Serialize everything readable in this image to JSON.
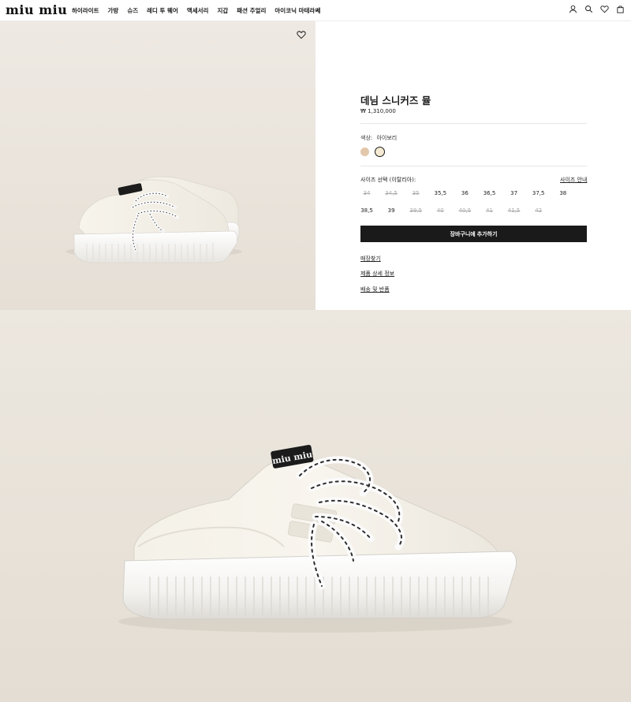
{
  "header": {
    "logo": "miu miu",
    "nav": [
      "하이라이트",
      "가방",
      "슈즈",
      "레디 투 웨어",
      "액세서리",
      "지갑",
      "패션 주얼리",
      "아이코닉 마테라쎄"
    ],
    "icons": [
      "account-icon",
      "search-icon",
      "wishlist-icon",
      "bag-icon"
    ]
  },
  "product": {
    "title": "데님 스니커즈 뮬",
    "price": "₩ 1,310,000",
    "color_label": "색상:",
    "color_value": "아이보리",
    "swatches": [
      "#e3c7ab",
      "#f4ead2"
    ],
    "size_label": "사이즈 선택 (이탈리아):",
    "size_guide": "사이즈 안내",
    "sizes_row1": [
      {
        "v": "34",
        "available": false
      },
      {
        "v": "34,5",
        "available": false
      },
      {
        "v": "35",
        "available": false
      },
      {
        "v": "35,5",
        "available": true
      },
      {
        "v": "36",
        "available": true
      },
      {
        "v": "36,5",
        "available": true
      },
      {
        "v": "37",
        "available": true
      },
      {
        "v": "37,5",
        "available": true
      },
      {
        "v": "38",
        "available": true
      }
    ],
    "sizes_row2": [
      {
        "v": "38,5",
        "available": true
      },
      {
        "v": "39",
        "available": true
      },
      {
        "v": "39,5",
        "available": false
      },
      {
        "v": "40",
        "available": false
      },
      {
        "v": "40,5",
        "available": false
      },
      {
        "v": "41",
        "available": false
      },
      {
        "v": "41,5",
        "available": false
      },
      {
        "v": "42",
        "available": false
      }
    ],
    "add_to_cart": "장바구니에 추가하기",
    "links": [
      "매장찾기",
      "제품 상세 정보",
      "배송 및 반품"
    ]
  },
  "shoe_branding": "miu miu"
}
